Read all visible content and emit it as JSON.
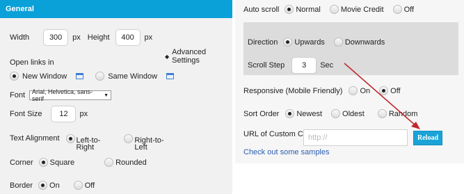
{
  "general": {
    "header": "General",
    "width_label": "Width",
    "width_value": "300",
    "width_unit": "px",
    "height_label": "Height",
    "height_value": "400",
    "height_unit": "px",
    "advanced_settings": "Advanced Settings",
    "open_links_label": "Open links in",
    "new_window": "New Window",
    "same_window": "Same Window",
    "font_label": "Font",
    "font_value": "Arial, Helvetica, sans-serif",
    "font_size_label": "Font Size",
    "font_size_value": "12",
    "font_size_unit": "px",
    "text_alignment_label": "Text Alignment",
    "align_left_line1": "Left-to-",
    "align_left_line2": "Right",
    "align_right_line1": "Right-to-",
    "align_right_line2": "Left",
    "corner_label": "Corner",
    "corner_square": "Square",
    "corner_rounded": "Rounded",
    "border_label": "Border",
    "border_on": "On",
    "border_off": "Off"
  },
  "scroll": {
    "auto_scroll_label": "Auto scroll",
    "normal": "Normal",
    "movie_credit": "Movie Credit",
    "off": "Off",
    "direction_label": "Direction",
    "upwards": "Upwards",
    "downwards": "Downwards",
    "scroll_step_label": "Scroll Step",
    "scroll_step_value": "3",
    "scroll_step_unit": "Sec",
    "responsive_label": "Responsive (Mobile Friendly)",
    "responsive_on": "On",
    "responsive_off": "Off",
    "sort_order_label": "Sort Order",
    "sort_newest": "Newest",
    "sort_oldest": "Oldest",
    "sort_random": "Random",
    "custom_css_label": "URL of Custom CSS",
    "custom_css_placeholder": "http://",
    "reload_button": "Reload",
    "samples_link": "Check out some samples"
  },
  "colors": {
    "header_blue": "#0aa0d8",
    "button_blue": "#1aa3d6",
    "annotation_red": "#c0282d",
    "link_blue": "#2a5db0"
  }
}
